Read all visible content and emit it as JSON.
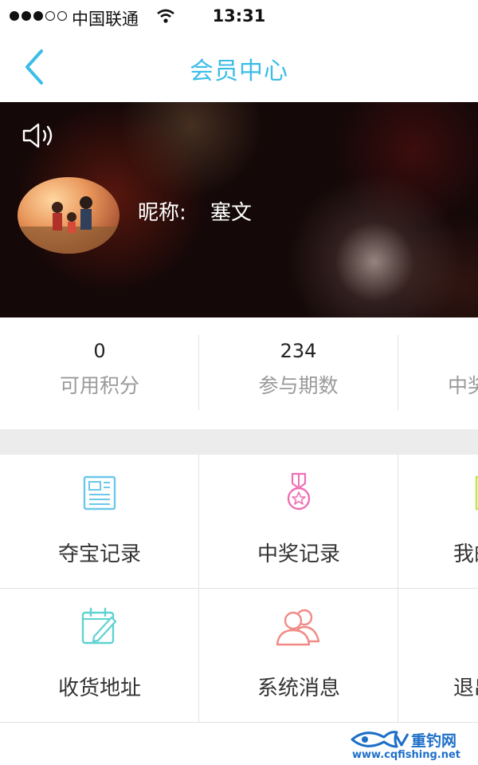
{
  "status_bar": {
    "carrier": "中国联通",
    "time": "13:31"
  },
  "nav": {
    "title": "会员中心",
    "back_icon": "chevron-left-icon"
  },
  "profile": {
    "nickname_label": "昵称:",
    "nickname": "塞文",
    "speaker_icon": "speaker-icon"
  },
  "stats": [
    {
      "value": "0",
      "label": "可用积分"
    },
    {
      "value": "234",
      "label": "参与期数"
    },
    {
      "value": "",
      "label": "中奖"
    }
  ],
  "menu": [
    {
      "label": "夺宝记录",
      "icon": "newspaper-icon",
      "color": "#6cc8ea"
    },
    {
      "label": "中奖记录",
      "icon": "medal-icon",
      "color": "#ef6fb5"
    },
    {
      "label": "我的",
      "icon": "document-icon",
      "color": "#c8e04a"
    },
    {
      "label": "收货地址",
      "icon": "notepad-pen-icon",
      "color": "#5fd2d2"
    },
    {
      "label": "系统消息",
      "icon": "users-icon",
      "color": "#f08a86"
    },
    {
      "label": "退出",
      "icon": "logout-icon",
      "color": "#6cc8ea"
    }
  ],
  "colors": {
    "accent": "#3cbde8",
    "gap": "#ececec"
  },
  "watermark": {
    "brand": "重钓网",
    "url": "www.cqfishing.net"
  }
}
